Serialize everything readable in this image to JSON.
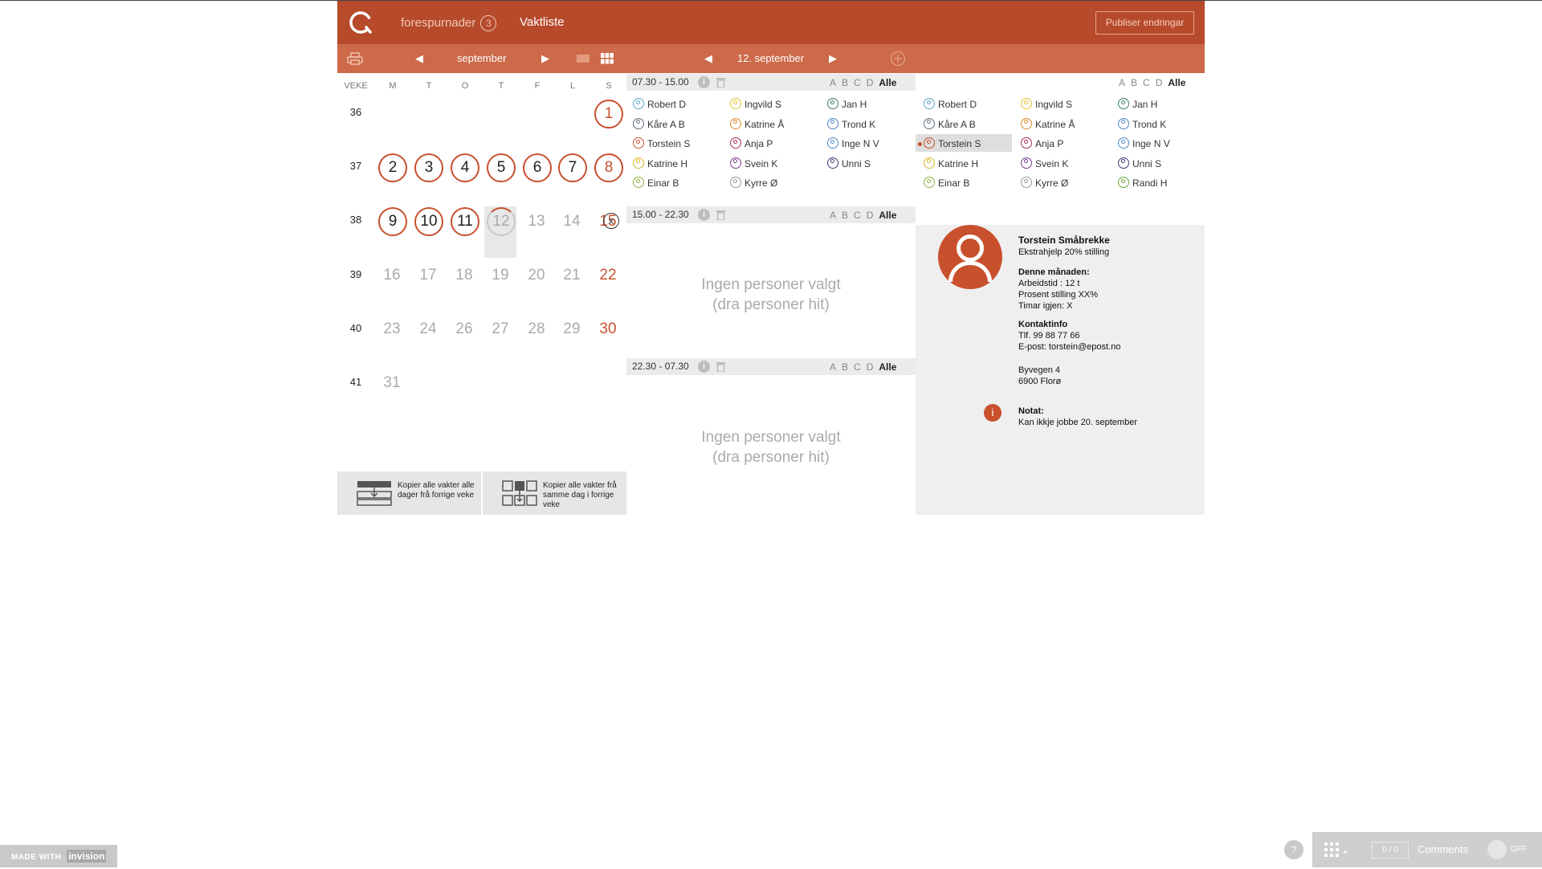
{
  "header": {
    "requests_label": "forespurnader",
    "requests_count": "3",
    "roster_label": "Vaktliste",
    "publish_label": "Publiser endringar"
  },
  "subbar": {
    "month": "september",
    "date": "12. september"
  },
  "calendar": {
    "week_header": "VEKE",
    "day_headers": [
      "M",
      "T",
      "O",
      "T",
      "F",
      "L",
      "S"
    ],
    "weeks": [
      "36",
      "37",
      "38",
      "39",
      "40",
      "41"
    ],
    "days": [
      "1",
      "2",
      "3",
      "4",
      "5",
      "6",
      "7",
      "8",
      "9",
      "10",
      "11",
      "12",
      "13",
      "14",
      "15",
      "16",
      "17",
      "18",
      "19",
      "20",
      "21",
      "22",
      "23",
      "24",
      "26",
      "27",
      "28",
      "29",
      "30",
      "31"
    ]
  },
  "copy": {
    "week_copy": "Kopier alle vakter alle dager frå forrige veke",
    "day_copy": "Kopier alle vakter frå samme dag i forrige veke"
  },
  "filter": {
    "a": "A",
    "b": "B",
    "c": "C",
    "d": "D",
    "all": "Alle"
  },
  "shifts": [
    {
      "time": "07.30 - 15.00"
    },
    {
      "time": "15.00 - 22.30"
    },
    {
      "time": "22.30 - 07.30"
    }
  ],
  "empty_line1": "Ingen personer valgt",
  "empty_line2": "(dra personer hit)",
  "shift1_people": [
    {
      "name": "Robert D",
      "color": "#5aa7c8"
    },
    {
      "name": "Ingvild S",
      "color": "#e2c62a"
    },
    {
      "name": "Jan H",
      "color": "#3e7a6e"
    },
    {
      "name": "Kåre A B",
      "color": "#607080"
    },
    {
      "name": "Katrine Å",
      "color": "#e08a2c"
    },
    {
      "name": "Trond K",
      "color": "#4f86c0"
    },
    {
      "name": "Torstein S",
      "color": "#c9502d"
    },
    {
      "name": "Anja P",
      "color": "#a8275a"
    },
    {
      "name": "Inge N V",
      "color": "#4f86c0"
    },
    {
      "name": "Katrine H",
      "color": "#d9b829"
    },
    {
      "name": "Svein K",
      "color": "#7b3b8c"
    },
    {
      "name": "Unni S",
      "color": "#3b3b7a"
    },
    {
      "name": "Einar B",
      "color": "#8ab33c"
    },
    {
      "name": "Kyrre Ø",
      "color": "#999999"
    }
  ],
  "all_people": [
    {
      "name": "Robert D",
      "color": "#5aa7c8"
    },
    {
      "name": "Ingvild S",
      "color": "#e2c62a"
    },
    {
      "name": "Jan H",
      "color": "#3e7a6e"
    },
    {
      "name": "Kåre A B",
      "color": "#607080"
    },
    {
      "name": "Katrine Å",
      "color": "#e08a2c"
    },
    {
      "name": "Trond K",
      "color": "#4f86c0"
    },
    {
      "name": "Torstein S",
      "color": "#c9502d"
    },
    {
      "name": "Anja P",
      "color": "#a8275a"
    },
    {
      "name": "Inge N V",
      "color": "#4f86c0"
    },
    {
      "name": "Katrine H",
      "color": "#d9b829"
    },
    {
      "name": "Svein K",
      "color": "#7b3b8c"
    },
    {
      "name": "Unni S",
      "color": "#3b3b7a"
    },
    {
      "name": "Einar B",
      "color": "#8ab33c"
    },
    {
      "name": "Kyrre Ø",
      "color": "#999999"
    },
    {
      "name": "Randi H",
      "color": "#6aa83c"
    }
  ],
  "profile": {
    "name": "Torstein Småbrekke",
    "role": "Ekstrahjelp 20% stilling",
    "month_title": "Denne månaden:",
    "work_time": "Arbeidstid : 12 t",
    "percent": "Prosent stilling XX%",
    "hours_left": "Timar igjen: X",
    "contact_title": "Kontaktinfo",
    "phone": "Tlf. 99 88 77 66",
    "email": "E-post: torstein@epost.no",
    "street": "Byvegen 4",
    "city": "6900 Florø",
    "note_title": "Notat:",
    "note": "Kan ikkje jobbe 20. september",
    "close": "x",
    "note_icon": "i"
  },
  "footer": {
    "made_with": "MADE WITH",
    "brand": "invision",
    "help": "?",
    "count_a": "0",
    "count_b": "0",
    "comments": "Comments",
    "toggle": "OFF"
  },
  "colors": {
    "brand": "#b64a2a",
    "subbar": "#cc6a49",
    "accent": "#c9502d"
  }
}
